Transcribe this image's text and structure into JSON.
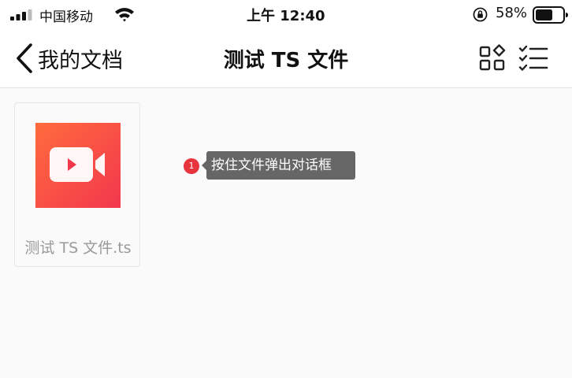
{
  "status_bar": {
    "carrier": "中国移动",
    "time": "上午 12:40",
    "battery": "58%"
  },
  "nav": {
    "back_label": "我的文档",
    "title": "测试 TS 文件",
    "grid_view_icon": "grid-view-icon",
    "select_icon": "checklist-icon"
  },
  "files": [
    {
      "name": "测试 TS 文件.ts",
      "icon": "video-icon",
      "thumb_color": "#f2374d"
    }
  ],
  "tooltip": {
    "badge": "1",
    "text": "按住文件弹出对话框"
  }
}
